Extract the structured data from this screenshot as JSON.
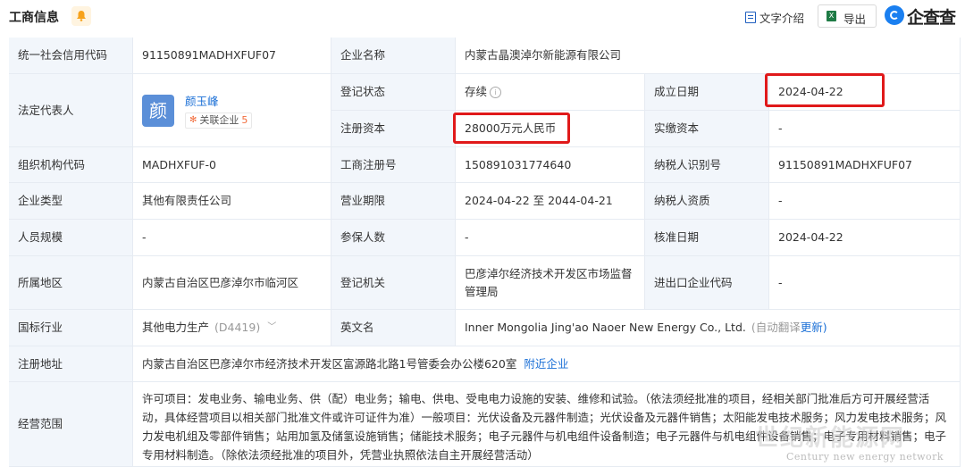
{
  "header": {
    "title": "工商信息",
    "intro_label": "文字介绍",
    "export_label": "导出",
    "export_icon": "X",
    "logo_text": "企查查"
  },
  "info": {
    "credit_code_label": "统一社会信用代码",
    "credit_code": "91150891MADHXFUF07",
    "company_name_label": "企业名称",
    "company_name": "内蒙古晶澳淖尔新能源有限公司",
    "legal_rep_label": "法定代表人",
    "legal_rep_avatar": "颜",
    "legal_rep_name": "颜玉峰",
    "related_label": "关联企业",
    "related_count": "5",
    "reg_status_label": "登记状态",
    "reg_status": "存续",
    "found_date_label": "成立日期",
    "found_date": "2024-04-22",
    "reg_capital_label": "注册资本",
    "reg_capital": "28000万元人民币",
    "paid_capital_label": "实缴资本",
    "paid_capital": "-",
    "org_code_label": "组织机构代码",
    "org_code": "MADHXFUF-0",
    "biz_reg_no_label": "工商注册号",
    "biz_reg_no": "150891031774640",
    "taxpayer_id_label": "纳税人识别号",
    "taxpayer_id": "91150891MADHXFUF07",
    "company_type_label": "企业类型",
    "company_type": "其他有限责任公司",
    "biz_term_label": "营业期限",
    "biz_term": "2024-04-22 至 2044-04-21",
    "taxpayer_qual_label": "纳税人资质",
    "taxpayer_qual": "-",
    "staff_size_label": "人员规模",
    "staff_size": "-",
    "insured_label": "参保人数",
    "insured": "-",
    "approve_date_label": "核准日期",
    "approve_date": "2024-04-22",
    "region_label": "所属地区",
    "region": "内蒙古自治区巴彦淖尔市临河区",
    "reg_authority_label": "登记机关",
    "reg_authority": "巴彦淖尔经济技术开发区市场监督管理局",
    "ie_code_label": "进出口企业代码",
    "ie_code": "-",
    "industry_label": "国标行业",
    "industry": "其他电力生产",
    "industry_code": "(D4419)",
    "english_name_label": "英文名",
    "english_name": "Inner Mongolia Jing'ao Naoer New Energy Co., Ltd.",
    "auto_translate": "(自动翻译",
    "update_link": "更新)",
    "address_label": "注册地址",
    "address": "内蒙古自治区巴彦淖尔市经济技术开发区富源路北路1号管委会办公楼620室",
    "nearby_link": "附近企业",
    "scope_label": "经营范围",
    "scope": "许可项目：发电业务、输电业务、供（配）电业务；输电、供电、受电电力设施的安装、维修和试验。（依法须经批准的项目，经相关部门批准后方可开展经营活动，具体经营项目以相关部门批准文件或许可证件为准）一般项目：光伏设备及元器件制造；光伏设备及元器件销售；太阳能发电技术服务；风力发电技术服务；风力发电机组及零部件销售；站用加氢及储氢设施销售；储能技术服务；电子元器件与机电组件设备制造；电子元器件与机电组件设备销售；电子专用材料销售；电子专用材料制造。（除依法须经批准的项目外，凭营业执照依法自主开展经营活动）"
  },
  "watermark": {
    "text": "Century new energy network",
    "big": "世纪新能源网"
  },
  "colors": {
    "label_bg": "#f2f6fb",
    "link": "#1a6fd6",
    "highlight": "#e0191a"
  }
}
